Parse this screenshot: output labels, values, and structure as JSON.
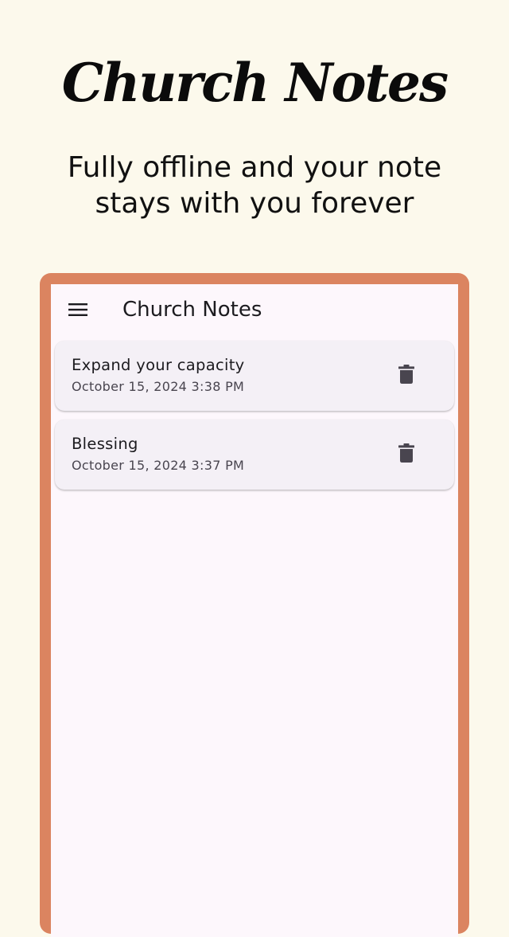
{
  "promo": {
    "title": "Church Notes",
    "subtitle": "Fully offline and your note stays with you forever"
  },
  "app_bar": {
    "menu_icon": "hamburger-menu-icon",
    "title": "Church Notes"
  },
  "notes": [
    {
      "title": "Expand your capacity",
      "date": "October 15, 2024 3:38 PM",
      "action_icon": "trash-icon"
    },
    {
      "title": "Blessing",
      "date": "October 15, 2024 3:37 PM",
      "action_icon": "trash-icon"
    }
  ],
  "colors": {
    "page_background": "#FCF9EC",
    "frame": "#DB8460",
    "screen_background": "#FDF7FC",
    "card_background": "#F4F0F6",
    "icon": "#49454F"
  }
}
